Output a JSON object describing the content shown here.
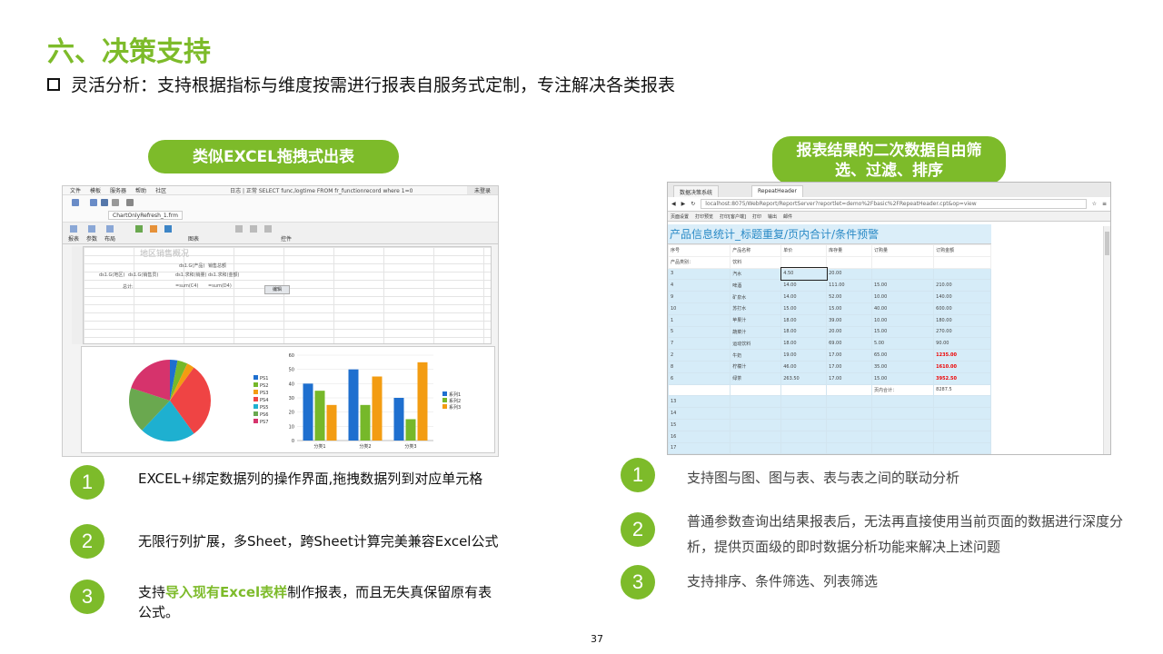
{
  "title": "六、决策支持",
  "subtitle": "灵活分析：支持根据指标与维度按需进行报表自服务式定制，专注解决各类报表",
  "left": {
    "pill": "类似EXCEL拖拽式出表",
    "menu": [
      "文件",
      "模板",
      "服务器",
      "帮助",
      "社区"
    ],
    "log": "日志 | 正常 SELECT func,logtime FROM fr_functionrecord where 1=0",
    "login": "未登录",
    "file_tab": "ChartOnlyRefresh_1.frm",
    "ribbon_labels": [
      "报表",
      "参数",
      "布局",
      "图表",
      "控件"
    ],
    "sheet_title": "地区销售概况",
    "cells": [
      "ds1.G(产品)",
      "销售总额",
      "ds1.G(地区)",
      "ds1.G(销售员)",
      "ds1.求和(销量)",
      "ds1.求和(金额)",
      "总计:",
      "=sum(C4)",
      "=sum(D4)"
    ],
    "edit_btn": "编辑",
    "pie": {
      "legend": [
        "PS1",
        "PS2",
        "PS3",
        "PS4",
        "PS5",
        "PS6",
        "PS7"
      ],
      "colors": [
        "#1e6fcf",
        "#76b82a",
        "#f39c12",
        "#ef4444",
        "#1eb0d0",
        "#6aa84f",
        "#d6336c"
      ],
      "values": [
        3,
        4,
        3,
        30,
        22,
        18,
        20
      ]
    },
    "bar": {
      "categories": [
        "分类1",
        "分类2",
        "分类3"
      ],
      "series": [
        {
          "name": "系列1",
          "color": "#1e6fcf",
          "values": [
            40,
            50,
            30
          ]
        },
        {
          "name": "系列2",
          "color": "#76b82a",
          "values": [
            35,
            25,
            15
          ]
        },
        {
          "name": "系列3",
          "color": "#f39c12",
          "values": [
            25,
            45,
            55
          ]
        }
      ],
      "y_ticks": [
        "0",
        "10",
        "20",
        "30",
        "40",
        "50",
        "60"
      ],
      "ylim": [
        0,
        60
      ]
    }
  },
  "right": {
    "pill": "报表结果的二次数据自由筛选、过滤、排序",
    "tabs": [
      "数据决策系统",
      "RepeatHeader"
    ],
    "url": "localhost:8075/WebReport/ReportServer?reportlet=demo%2Fbasic%2FRepeatHeader.cpt&op=view",
    "toolbar": [
      "页面设置",
      "打印预览",
      "打印[客户端]",
      "打印",
      "输出",
      "邮件"
    ],
    "report_title": "产品信息统计_标题重复/页内合计/条件预警",
    "headers": [
      "序号",
      "产品名称",
      "单价",
      "库存量",
      "订购量",
      "订购金额"
    ],
    "subheader": [
      "产品类别：",
      "饮料"
    ],
    "rows": [
      [
        "3",
        "汽水",
        "4.50",
        "20.00",
        "",
        ""
      ],
      [
        "4",
        "啤酒",
        "14.00",
        "111.00",
        "15.00",
        "210.00"
      ],
      [
        "9",
        "矿泉水",
        "14.00",
        "52.00",
        "10.00",
        "140.00"
      ],
      [
        "10",
        "苏打水",
        "15.00",
        "15.00",
        "40.00",
        "600.00"
      ],
      [
        "1",
        "苹果汁",
        "18.00",
        "39.00",
        "10.00",
        "180.00"
      ],
      [
        "5",
        "蔬菜汁",
        "18.00",
        "20.00",
        "15.00",
        "270.00"
      ],
      [
        "7",
        "运动饮料",
        "18.00",
        "69.00",
        "5.00",
        "90.00"
      ],
      [
        "2",
        "牛奶",
        "19.00",
        "17.00",
        "65.00",
        "1235.00"
      ],
      [
        "8",
        "柠檬汁",
        "46.00",
        "17.00",
        "35.00",
        "1610.00"
      ],
      [
        "6",
        "绿茶",
        "263.50",
        "17.00",
        "15.00",
        "3952.50"
      ]
    ],
    "red_rows": [
      7,
      8,
      9
    ],
    "total": [
      "页内合计：",
      "8287.5"
    ],
    "empty_rows": [
      "13",
      "14",
      "15",
      "16",
      "17"
    ]
  },
  "bullets_left": [
    {
      "n": "1",
      "text": "EXCEL+绑定数据列的操作界面,拖拽数据列到对应单元格"
    },
    {
      "n": "2",
      "text": "无限行列扩展，多Sheet，跨Sheet计算完美兼容Excel公式"
    },
    {
      "n": "3",
      "pre": "支持",
      "hl": "导入现有Excel表样",
      "post": "制作报表，而且无失真保留原有表公式。"
    }
  ],
  "bullets_right": [
    {
      "n": "1",
      "text": "支持图与图、图与表、表与表之间的联动分析"
    },
    {
      "n": "2",
      "text": "普通参数查询出结果报表后，无法再直接使用当前页面的数据进行深度分析，提供页面级的即时数据分析功能来解决上述问题"
    },
    {
      "n": "3",
      "text": "支持排序、条件筛选、列表筛选"
    }
  ],
  "page_number": "37"
}
